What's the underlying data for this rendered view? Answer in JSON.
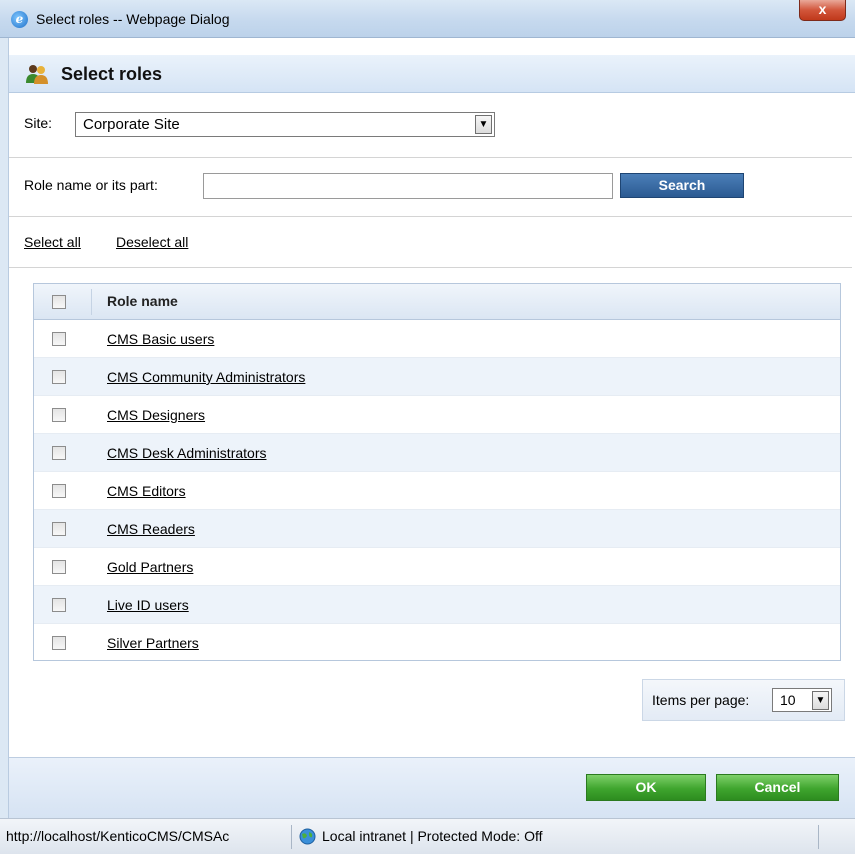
{
  "window": {
    "title": "Select roles -- Webpage Dialog",
    "close_label": "x"
  },
  "header": {
    "title": "Select roles"
  },
  "site": {
    "label": "Site:",
    "selected": "Corporate Site"
  },
  "search": {
    "label": "Role name or its part:",
    "value": "",
    "button": "Search"
  },
  "links": {
    "select_all": "Select all",
    "deselect_all": "Deselect all"
  },
  "grid": {
    "column_header": "Role name",
    "rows": [
      "CMS Basic users",
      "CMS Community Administrators",
      "CMS Designers",
      "CMS Desk Administrators",
      "CMS Editors",
      "CMS Readers",
      "Gold Partners",
      "Live ID users",
      "Silver Partners"
    ]
  },
  "pager": {
    "label": "Items per page:",
    "selected": "10"
  },
  "footer": {
    "ok": "OK",
    "cancel": "Cancel"
  },
  "statusbar": {
    "url": "http://localhost/KenticoCMS/CMSAc",
    "zone": "Local intranet | Protected Mode: Off"
  }
}
